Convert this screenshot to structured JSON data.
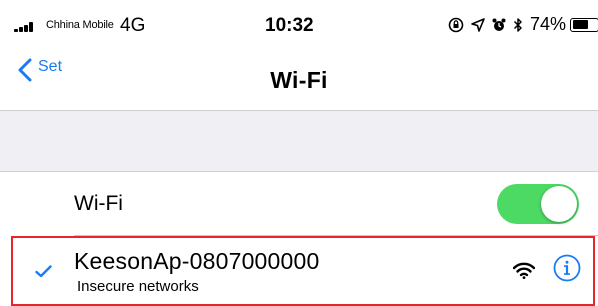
{
  "status_bar": {
    "carrier": "Chhina Mobile",
    "network_type": "4G",
    "time": "10:32",
    "battery_percent": "74%",
    "battery_level": 0.74,
    "icons": [
      "signal-icon",
      "lock-rotation-icon",
      "location-icon",
      "alarm-icon",
      "bluetooth-icon",
      "battery-icon"
    ]
  },
  "nav": {
    "back_label": "Set",
    "title": "Wi-Fi"
  },
  "wifi_toggle": {
    "label": "Wi-Fi",
    "on": true,
    "color": "#4cd964"
  },
  "networks": [
    {
      "name": "KeesonAp-0807000000",
      "subtitle": "Insecure networks",
      "connected": true
    }
  ],
  "colors": {
    "accent": "#1a7cf5",
    "highlight_border": "#e5262f",
    "group_background": "#efeff4"
  }
}
